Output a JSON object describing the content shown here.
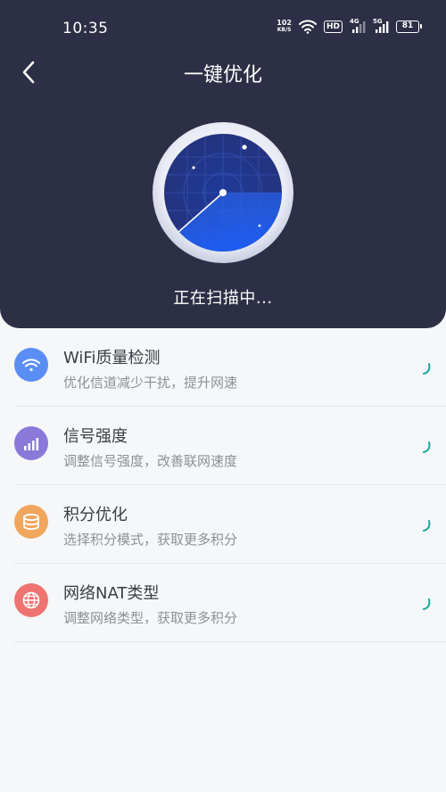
{
  "status_bar": {
    "time": "10:35",
    "net_speed_value": "102",
    "net_speed_unit": "KB/S",
    "hd_label": "HD",
    "signal1_label": "4G",
    "signal2_label": "5G",
    "battery": "81"
  },
  "header": {
    "title": "一键优化",
    "scan_status": "正在扫描中..."
  },
  "items": [
    {
      "name": "WiFi质量检测",
      "desc": "优化信道减少干扰，提升网速",
      "icon": "wifi-icon",
      "color": "#5b8ef5"
    },
    {
      "name": "信号强度",
      "desc": "调整信号强度，改善联网速度",
      "icon": "signal-bars-icon",
      "color": "#8a79d8"
    },
    {
      "name": "积分优化",
      "desc": "选择积分模式，获取更多积分",
      "icon": "coins-icon",
      "color": "#f0a65c"
    },
    {
      "name": "网络NAT类型",
      "desc": "调整网络类型，获取更多积分",
      "icon": "globe-icon",
      "color": "#ef7471"
    }
  ],
  "colors": {
    "header_bg": "#2c2f45",
    "accent_spinner": "#1aa79a"
  }
}
